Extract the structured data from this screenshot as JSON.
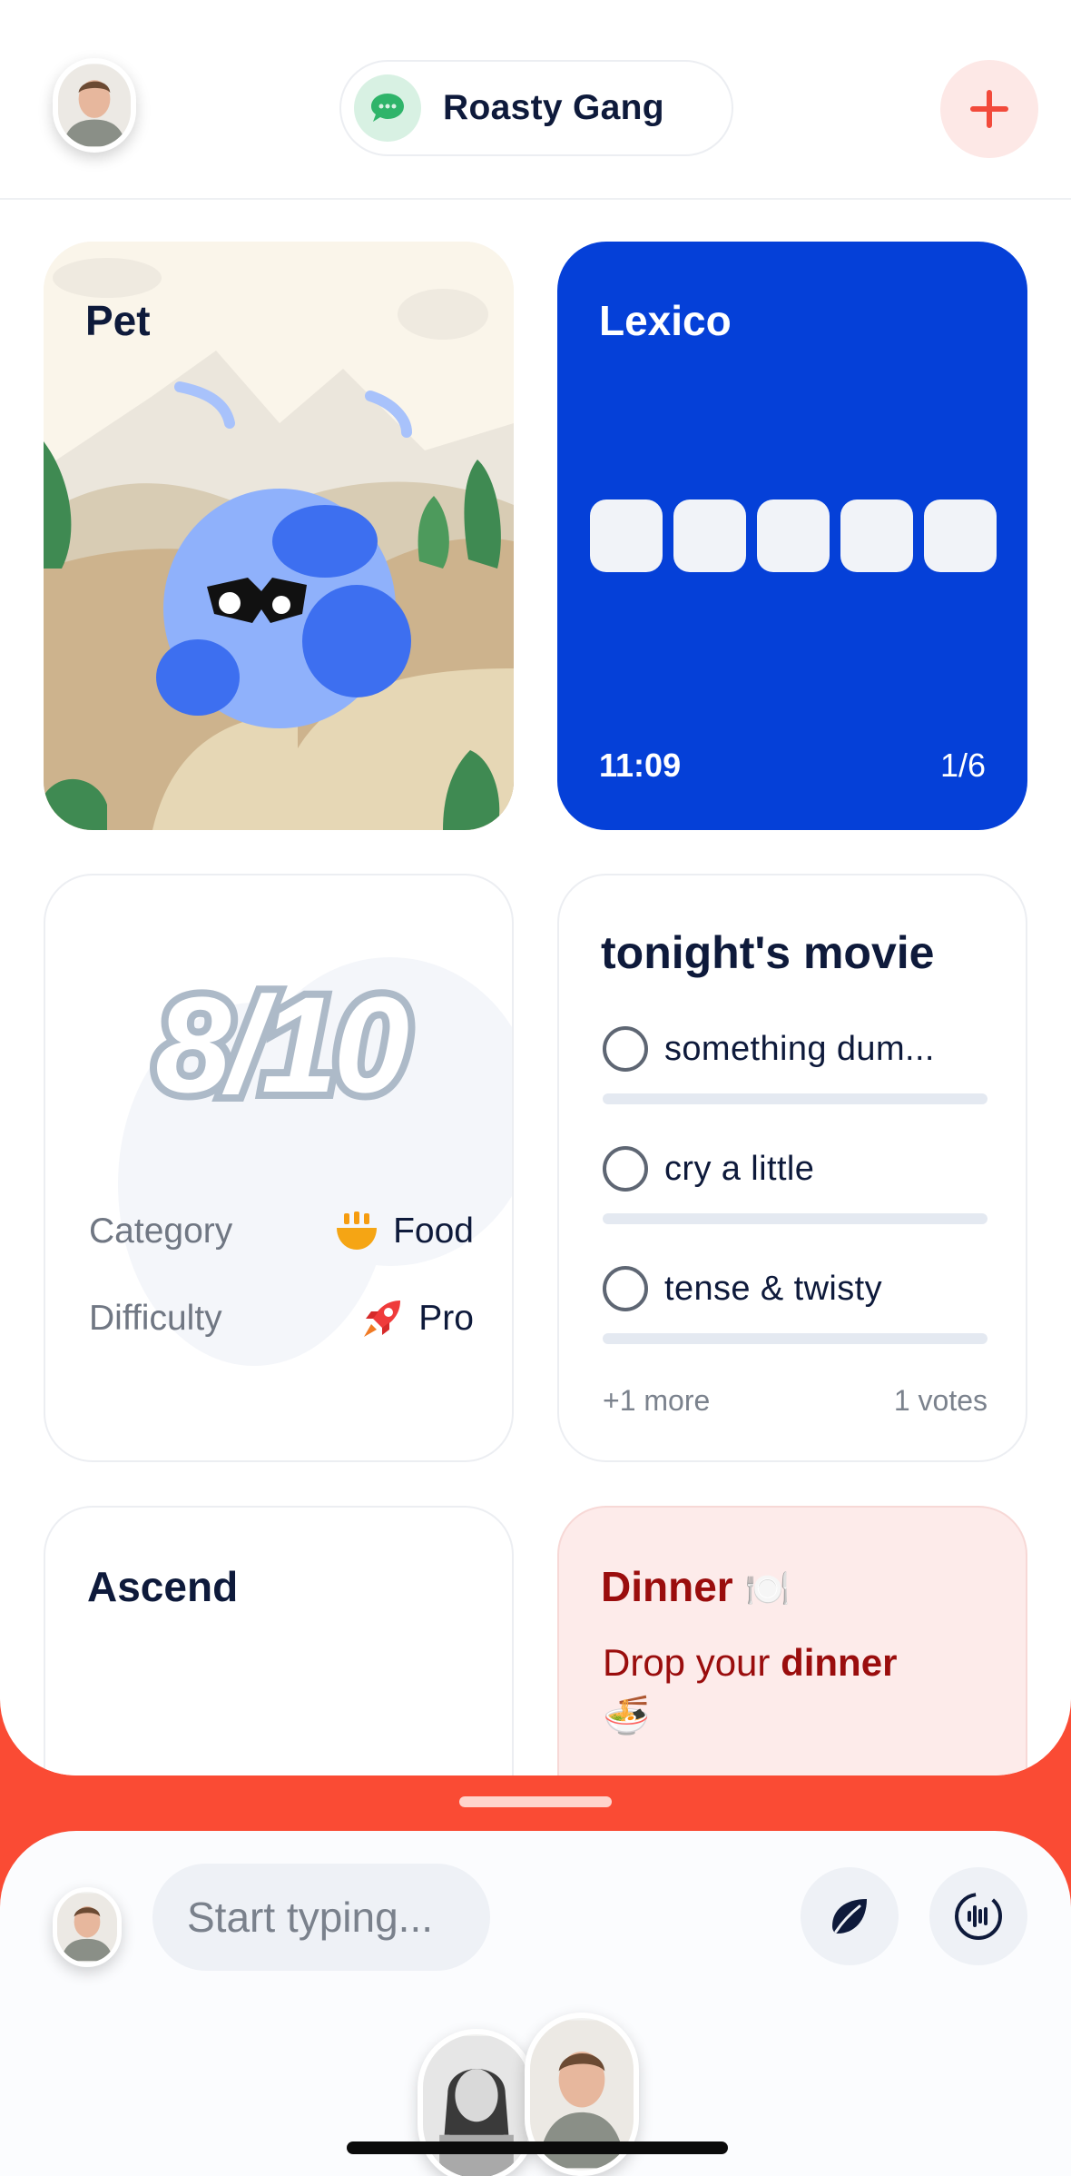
{
  "header": {
    "group_name": "Roasty Gang",
    "add_label": "+"
  },
  "cards": {
    "pet": {
      "title": "Pet"
    },
    "lexico": {
      "title": "Lexico",
      "time": "11:09",
      "count": "1/6",
      "tiles": 5
    },
    "score": {
      "value": "8/10",
      "category_label": "Category",
      "category_value": "Food",
      "category_icon": "bowl-icon",
      "difficulty_label": "Difficulty",
      "difficulty_value": "Pro",
      "difficulty_icon": "rocket-icon"
    },
    "poll": {
      "title": "tonight's movie",
      "options": [
        "something dum...",
        "cry a little",
        "tense & twisty"
      ],
      "more": "+1 more",
      "votes": "1 votes"
    },
    "ascend": {
      "title": "Ascend"
    },
    "dinner": {
      "title": "Dinner",
      "title_emoji": "🍽️",
      "body_prefix": "Drop your ",
      "body_bold": "dinner",
      "body_emoji": "🍜"
    }
  },
  "composer": {
    "placeholder": "Start typing..."
  },
  "colors": {
    "accent": "#fa4b34",
    "lexico_blue": "#0540d8",
    "navy_text": "#0e1a3b",
    "dinner_text": "#9a0d0d"
  }
}
